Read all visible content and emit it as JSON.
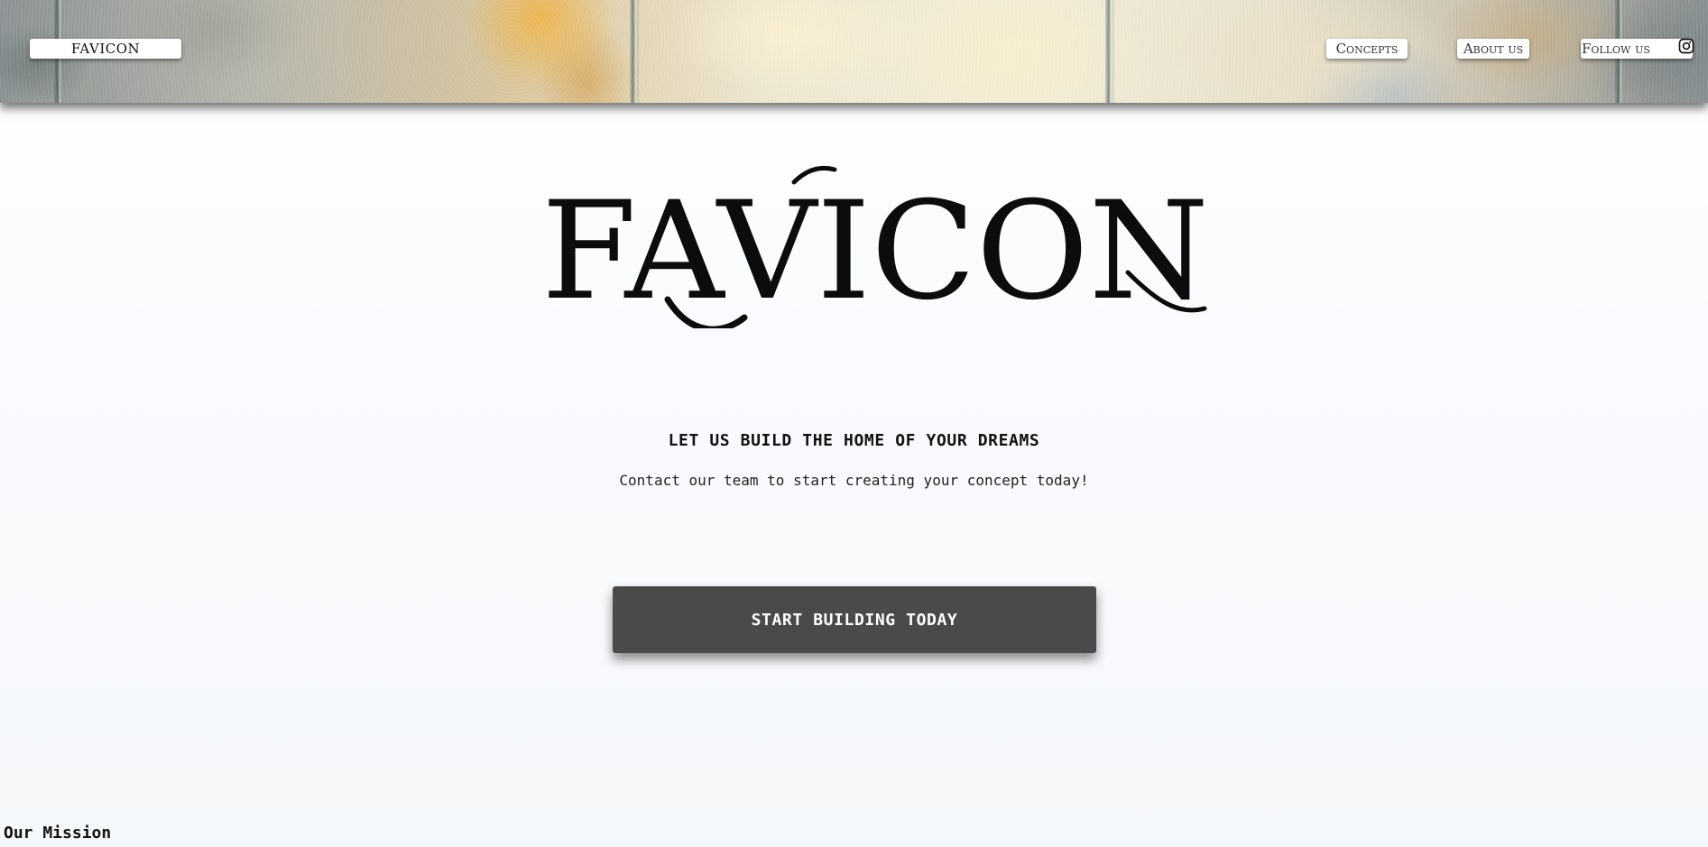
{
  "header": {
    "brand_label": "FAVICON",
    "nav": [
      {
        "label": "Concepts"
      },
      {
        "label": "About us"
      },
      {
        "label": "Follow us"
      }
    ],
    "social_icon": "instagram-icon"
  },
  "hero": {
    "logo_text": "FAVICON",
    "heading": "LET US BUILD THE HOME OF YOUR DREAMS",
    "subheading": "Contact our team to start creating your concept today!",
    "cta_label": "START BUILDING TODAY"
  },
  "mission": {
    "heading": "Our Mission"
  },
  "colors": {
    "cta_background": "#4a4a4a",
    "text": "#111111",
    "page_background": "#f7f9fb"
  }
}
